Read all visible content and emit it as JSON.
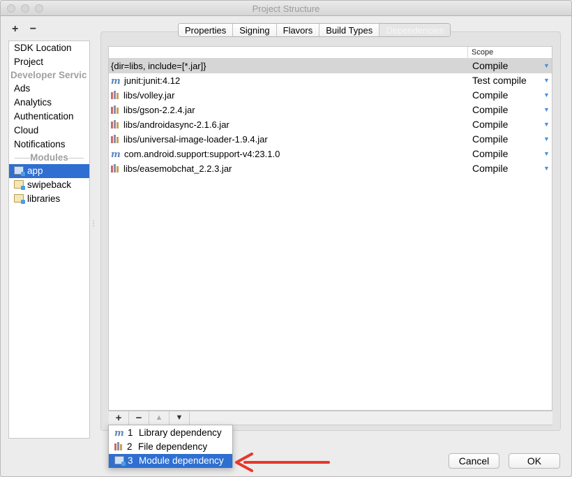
{
  "window": {
    "title": "Project Structure"
  },
  "sidebar": {
    "add_label": "+",
    "remove_label": "−",
    "items": [
      {
        "label": "SDK Location",
        "kind": "item"
      },
      {
        "label": "Project",
        "kind": "item"
      },
      {
        "label": "Developer Servic",
        "kind": "header"
      },
      {
        "label": "Ads",
        "kind": "item"
      },
      {
        "label": "Analytics",
        "kind": "item"
      },
      {
        "label": "Authentication",
        "kind": "item"
      },
      {
        "label": "Cloud",
        "kind": "item"
      },
      {
        "label": "Notifications",
        "kind": "item"
      },
      {
        "label": "Modules",
        "kind": "section"
      },
      {
        "label": "app",
        "kind": "module",
        "selected": true
      },
      {
        "label": "swipeback",
        "kind": "module"
      },
      {
        "label": "libraries",
        "kind": "module"
      }
    ]
  },
  "tabs": [
    {
      "label": "Properties"
    },
    {
      "label": "Signing"
    },
    {
      "label": "Flavors"
    },
    {
      "label": "Build Types"
    },
    {
      "label": "Dependencies",
      "active": true
    }
  ],
  "table": {
    "scope_header": "Scope",
    "rows": [
      {
        "name": "{dir=libs, include=[*.jar]}",
        "scope": "Compile",
        "icon": "none",
        "selected": true
      },
      {
        "name": "junit:junit:4.12",
        "scope": "Test compile",
        "icon": "maven-icon"
      },
      {
        "name": "libs/volley.jar",
        "scope": "Compile",
        "icon": "jar-icon"
      },
      {
        "name": "libs/gson-2.2.4.jar",
        "scope": "Compile",
        "icon": "jar-icon"
      },
      {
        "name": "libs/androidasync-2.1.6.jar",
        "scope": "Compile",
        "icon": "jar-icon"
      },
      {
        "name": "libs/universal-image-loader-1.9.4.jar",
        "scope": "Compile",
        "icon": "jar-icon"
      },
      {
        "name": "com.android.support:support-v4:23.1.0",
        "scope": "Compile",
        "icon": "maven-icon"
      },
      {
        "name": "libs/easemobchat_2.2.3.jar",
        "scope": "Compile",
        "icon": "jar-icon"
      }
    ]
  },
  "toolbar": {
    "add": "+",
    "remove": "−",
    "up": "▲",
    "down": "▼"
  },
  "popup": {
    "items": [
      {
        "num": "1",
        "label": "Library dependency",
        "icon": "maven-icon"
      },
      {
        "num": "2",
        "label": "File dependency",
        "icon": "jar-icon"
      },
      {
        "num": "3",
        "label": "Module dependency",
        "icon": "module-icon",
        "selected": true
      }
    ]
  },
  "buttons": {
    "cancel": "Cancel",
    "ok": "OK"
  },
  "colors": {
    "accent": "#2e6fd1",
    "annotation_arrow": "#e8372b",
    "scope_arrow": "#4a8fd6"
  }
}
